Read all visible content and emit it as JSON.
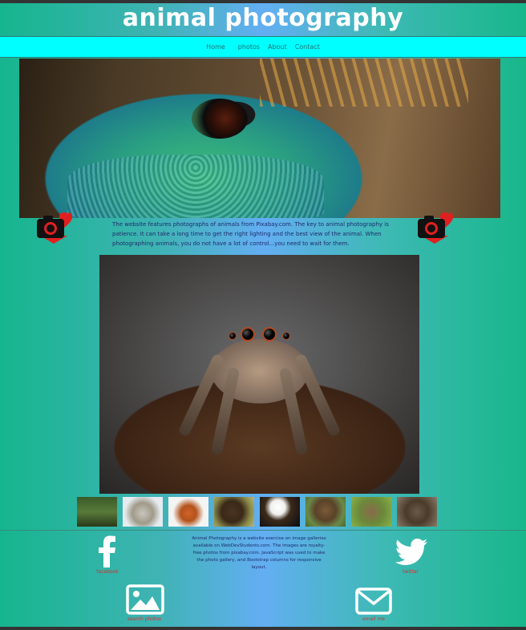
{
  "site": {
    "title": "animal photography"
  },
  "nav": {
    "items": [
      {
        "label": "Home"
      },
      {
        "label": "photos"
      },
      {
        "label": "About"
      },
      {
        "label": "Contact"
      }
    ]
  },
  "intro": {
    "text": "The website features photographs of animals from Pixabay.com. The key to animal photography is patience. It can take a long time to get the right lighting and the best view of the animal. When photographing animals, you do not have a lot of control...you need to wait for them."
  },
  "icons": {
    "camera": "camera-heart-icon",
    "facebook": "facebook-icon",
    "twitter": "twitter-icon",
    "image": "image-icon",
    "mail": "mail-icon"
  },
  "gallery": {
    "thumbnails": [
      "deer",
      "hedgehog",
      "fox",
      "bison",
      "eagle",
      "otter",
      "rabbit",
      "spider"
    ]
  },
  "footer": {
    "text": "Animal Photography is a website exercise on image galleries available on WebDevStudents.com. The images are royalty-free photos from pixabay.com. JavaScript was used to make the photo gallery, and Bootstrap columns for responsive layout.",
    "facebook_label": "facebook",
    "twitter_label": "twitter",
    "search_label": "search photos",
    "email_label": "email me"
  },
  "colors": {
    "nav_bg": "#00ffff",
    "icon_label": "#d32f2f",
    "heart": "#e02020"
  }
}
